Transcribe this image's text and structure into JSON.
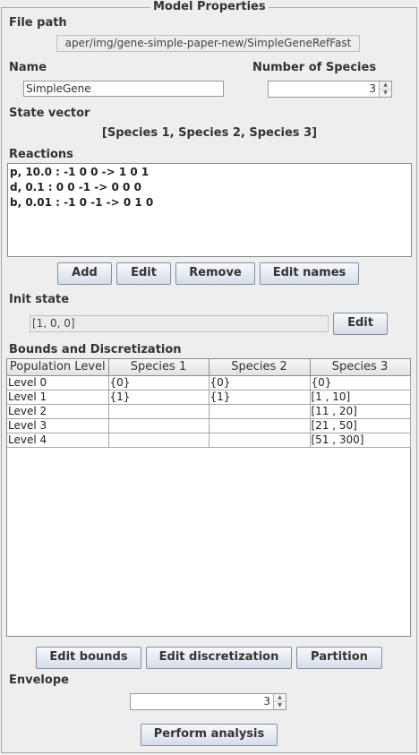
{
  "panel": {
    "title": "Model Properties"
  },
  "file_path": {
    "label": "File path",
    "value": "aper/img/gene-simple-paper-new/SimpleGeneRefFast"
  },
  "name": {
    "label": "Name",
    "value": "SimpleGene"
  },
  "num_species": {
    "label": "Number of Species",
    "value": "3"
  },
  "state_vector": {
    "label": "State vector",
    "value": "[Species 1, Species 2, Species 3]"
  },
  "reactions": {
    "label": "Reactions",
    "lines": [
      "p, 10.0 : -1 0 0 -> 1 0 1",
      "d, 0.1 : 0 0 -1 -> 0 0 0",
      "b, 0.01 : -1 0 -1 -> 0 1 0"
    ],
    "buttons": {
      "add": "Add",
      "edit": "Edit",
      "remove": "Remove",
      "edit_names": "Edit names"
    }
  },
  "init_state": {
    "label": "Init state",
    "value": "[1, 0, 0]",
    "edit": "Edit"
  },
  "bounds": {
    "label": "Bounds and Discretization",
    "headers": [
      "Population Level",
      "Species 1",
      "Species 2",
      "Species 3"
    ],
    "rows": [
      [
        "Level 0",
        "{0}",
        "{0}",
        "{0}"
      ],
      [
        "Level 1",
        "{1}",
        "{1}",
        "[1 , 10]"
      ],
      [
        "Level 2",
        "",
        "",
        "[11 , 20]"
      ],
      [
        "Level 3",
        "",
        "",
        "[21 , 50]"
      ],
      [
        "Level 4",
        "",
        "",
        "[51 , 300]"
      ]
    ],
    "buttons": {
      "edit_bounds": "Edit bounds",
      "edit_discretization": "Edit discretization",
      "partition": "Partition"
    }
  },
  "envelope": {
    "label": "Envelope",
    "value": "3"
  },
  "perform": "Perform analysis"
}
